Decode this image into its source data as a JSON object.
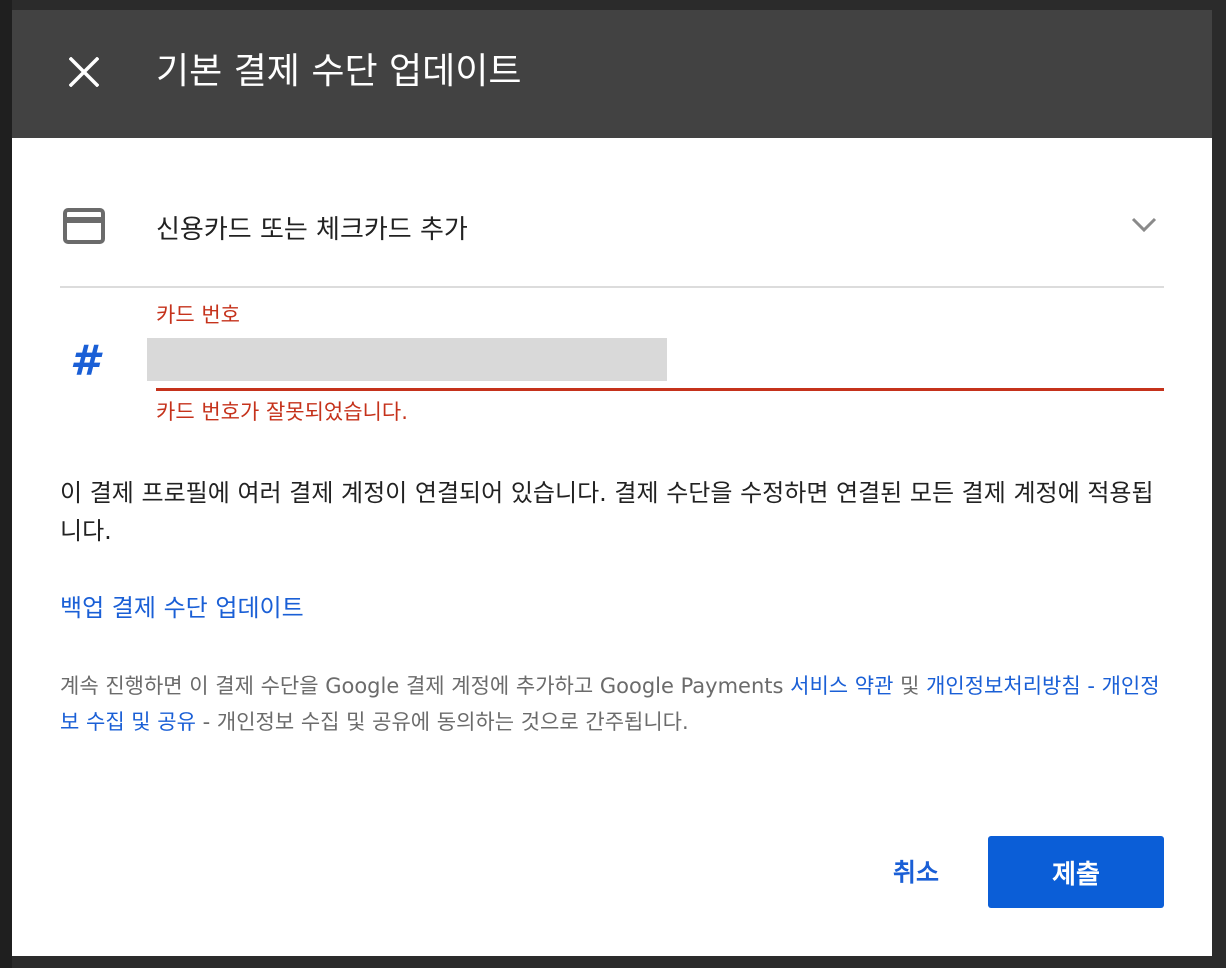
{
  "dialog": {
    "title": "기본 결제 수단 업데이트",
    "close_icon": "close-icon"
  },
  "payment_method": {
    "icon": "credit-card-icon",
    "label": "신용카드 또는 체크카드 추가",
    "expand_icon": "chevron-down-icon"
  },
  "card_number_field": {
    "icon": "hash-icon",
    "hash_glyph": "#",
    "label": "카드 번호",
    "value": "",
    "error": "카드 번호가 잘못되었습니다."
  },
  "notice": "이 결제 프로필에 여러 결제 계정이 연결되어 있습니다. 결제 수단을 수정하면 연결된 모든 결제 계정에 적용됩니다.",
  "backup_link": "백업 결제 수단 업데이트",
  "legal": {
    "prefix": "계속 진행하면 이 결제 수단을 Google 결제 계정에 추가하고 Google Payments ",
    "terms_link": "서비스 약관",
    "and": " 및 ",
    "privacy_link": "개인정보처리방침 - 개인정보 수집 및 공유",
    "suffix": " - 개인정보 수집 및 공유에 동의하는 것으로 간주됩니다."
  },
  "actions": {
    "cancel_label": "취소",
    "submit_label": "제출"
  },
  "colors": {
    "header_bg": "#424242",
    "accent": "#1a5fd6",
    "error": "#c5321b",
    "submit_bg": "#0b5ed7"
  }
}
